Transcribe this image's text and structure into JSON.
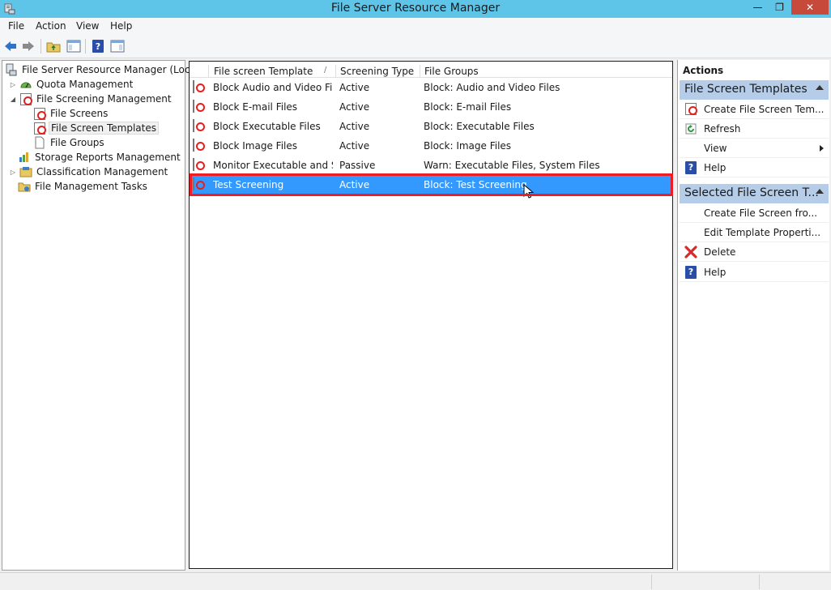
{
  "window": {
    "title": "File Server Resource Manager",
    "min_glyph": "—",
    "max_glyph": "❐",
    "close_glyph": "✕"
  },
  "menu": [
    "File",
    "Action",
    "View",
    "Help"
  ],
  "tree": {
    "root": "File Server Resource Manager (Local)",
    "quota": "Quota Management",
    "screening": "File Screening Management",
    "file_screens": "File Screens",
    "templates": "File Screen Templates",
    "groups": "File Groups",
    "storage": "Storage Reports Management",
    "classification": "Classification Management",
    "tasks": "File Management Tasks"
  },
  "list": {
    "columns": [
      "File screen Template",
      "Screening Type",
      "File Groups"
    ],
    "sort_glyph": "/",
    "rows": [
      {
        "template": "Block Audio and Video Fil...",
        "type": "Active",
        "groups": "Block: Audio and Video Files"
      },
      {
        "template": "Block E-mail Files",
        "type": "Active",
        "groups": "Block: E-mail Files"
      },
      {
        "template": "Block Executable Files",
        "type": "Active",
        "groups": "Block: Executable Files"
      },
      {
        "template": "Block Image Files",
        "type": "Active",
        "groups": "Block: Image Files"
      },
      {
        "template": "Monitor Executable and S...",
        "type": "Passive",
        "groups": "Warn: Executable Files, System Files"
      },
      {
        "template": "Test Screening",
        "type": "Active",
        "groups": "Block: Test Screening"
      }
    ]
  },
  "actions": {
    "header": "Actions",
    "group1": {
      "title": "File Screen Templates",
      "items": [
        "Create File Screen Tem...",
        "Refresh",
        "View",
        "Help"
      ]
    },
    "group2": {
      "title": "Selected File Screen T...",
      "items": [
        "Create File Screen fro...",
        "Edit Template Properti...",
        "Delete",
        "Help"
      ]
    }
  }
}
